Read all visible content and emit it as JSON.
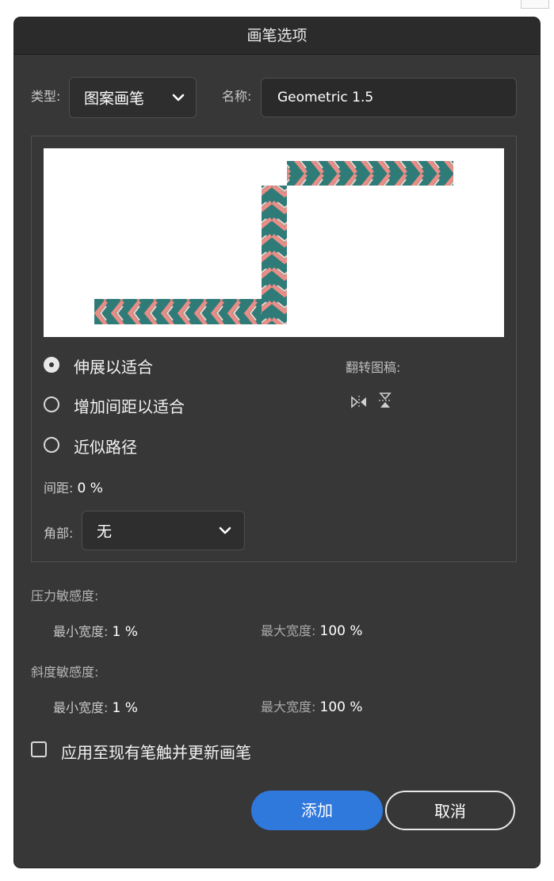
{
  "dialog": {
    "title": "画笔选项"
  },
  "type": {
    "label": "类型:",
    "value": "图案画笔"
  },
  "name": {
    "label": "名称:",
    "value": "Geometric 1.5"
  },
  "fit_options": [
    {
      "label": "伸展以适合",
      "checked": true
    },
    {
      "label": "增加间距以适合",
      "checked": false
    },
    {
      "label": "近似路径",
      "checked": false
    }
  ],
  "flip": {
    "label": "翻转图稿:",
    "icons": [
      "flip-horizontal-icon",
      "flip-vertical-icon"
    ]
  },
  "spacing": {
    "label": "间距:",
    "value": "0 %"
  },
  "corner": {
    "label": "角部:",
    "value": "无"
  },
  "pressure": {
    "title": "压力敏感度:",
    "min_label": "最小宽度:",
    "min_value": "1 %",
    "max_label": "最大宽度:",
    "max_value": "100 %"
  },
  "tilt": {
    "title": "斜度敏感度:",
    "min_label": "最小宽度:",
    "min_value": "1 %",
    "max_label": "最大宽度:",
    "max_value": "100 %"
  },
  "apply_checkbox": {
    "label": "应用至现有笔触并更新画笔",
    "checked": false
  },
  "buttons": {
    "add": "添加",
    "cancel": "取消"
  },
  "colors": {
    "dialog_bg": "#373737",
    "accent": "#2f78dc",
    "pattern_teal": "#2e7b78",
    "pattern_pink": "#e98d86",
    "pattern_light": "#f6d3cb"
  }
}
